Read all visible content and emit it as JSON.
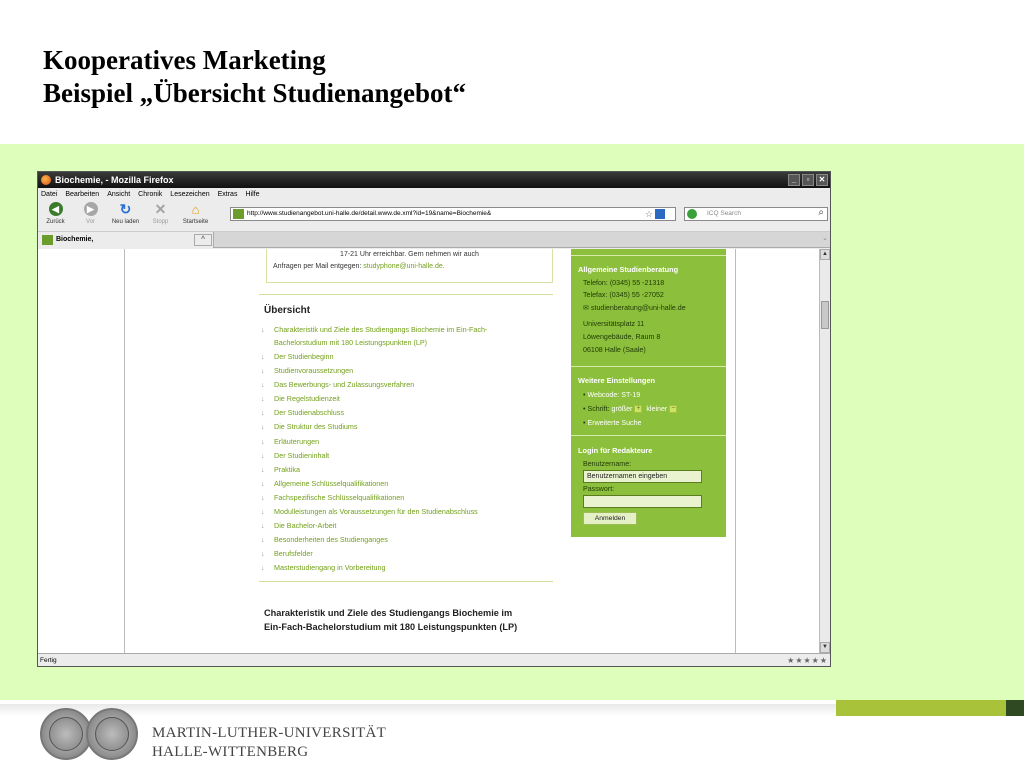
{
  "slide": {
    "title_line1": "Kooperatives Marketing",
    "title_line2": "Beispiel „Übersicht Studienangebot“",
    "footer_line1": "MARTIN-LUTHER-UNIVERSITÄT",
    "footer_line2": "HALLE-WITTENBERG"
  },
  "browser": {
    "window_title": "Biochemie, - Mozilla Firefox",
    "menu": [
      "Datei",
      "Bearbeiten",
      "Ansicht",
      "Chronik",
      "Lesezeichen",
      "Extras",
      "Hilfe"
    ],
    "toolbar": {
      "back": "Zurück",
      "forward": "Vor",
      "reload": "Neu laden",
      "stop": "Stopp",
      "home": "Startseite"
    },
    "url": "http://www.studienangebot.uni-halle.de/detail.www.de.xml?id=19&name=Biochemie&",
    "search_placeholder": "ICQ Search",
    "tab_label": "Biochemie,",
    "status": "Fertig"
  },
  "page": {
    "contact_line1": "17-21 Uhr erreichbar. Gern nehmen wir auch",
    "contact_line2_prefix": "Anfragen per Mail entgegen: ",
    "contact_mail": "studyphone@uni-halle.de.",
    "overview_heading": "Übersicht",
    "toc_first_line1": "Charakteristik und Ziele des Studiengangs Biochemie im Ein-Fach-",
    "toc_first_line2": "Bachelorstudium mit 180 Leistungspunkten (LP)",
    "toc": [
      "Der Studienbeginn",
      "Studienvoraussetzungen",
      "Das Bewerbungs-  und Zulassungsverfahren",
      "Die Regelstudienzeit",
      "Der Studienabschluss",
      "Die Struktur des Studiums",
      "Erläuterungen",
      "Der Studieninhalt",
      "Praktika",
      "Allgemeine Schlüsselqualifikationen",
      "Fachspezifische Schlüsselqualifikationen",
      "Modulleistungen als Voraussetzungen für den Studienabschluss",
      "Die Bachelor-Arbeit",
      "Besonderheiten des Studienganges",
      "Berufsfelder",
      "Masterstudiengang in Vorbereitung"
    ],
    "section_title_line1": "Charakteristik und Ziele des Studiengangs Biochemie im",
    "section_title_line2": "Ein-Fach-Bachelorstudium mit 180 Leistungspunkten (LP)"
  },
  "sidebar": {
    "advice_heading": "Allgemeine Studienberatung",
    "phone": "Telefon: (0345) 55 -21318",
    "fax": "Telefax: (0345) 55 -27052",
    "email": "studienberatung@uni-halle.de",
    "address1": "Universitätsplatz 11",
    "address2": "Löwengebäude, Raum 8",
    "address3": "06108 Halle (Saale)",
    "settings_heading": "Weitere Einstellungen",
    "webcode": "Webcode: ST-19",
    "font_prefix": "Schrift:",
    "font_bigger": "größer",
    "font_smaller": "kleiner",
    "advanced_search": "Erweiterte Suche",
    "login_heading": "Login für Redakteure",
    "username_label": "Benutzername:",
    "username_value": "Benutzernamen eingeben",
    "password_label": "Passwort:",
    "login_button": "Anmelden"
  },
  "colors": {
    "band_green": "#ddffbb",
    "sidebar_green": "#8cbf3b",
    "link_green": "#73a01b",
    "footer_green": "#a8c23a"
  }
}
